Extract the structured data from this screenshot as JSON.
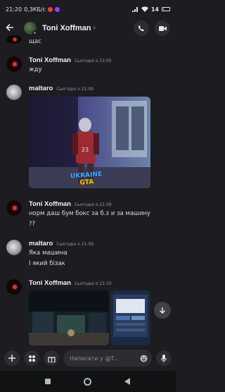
{
  "status_bar": {
    "time": "21:20",
    "speed": "0,3КБ/с",
    "battery": "14"
  },
  "header": {
    "contact_name": "Toni Xoffman",
    "chevron": "›"
  },
  "composer": {
    "placeholder": "Написати у @T..."
  },
  "messages": [
    {
      "author": "",
      "timestamp": "",
      "lines": [
        "щас"
      ]
    },
    {
      "author": "Toni Xoffman",
      "timestamp": "Сьогодні о 21:05",
      "lines": [
        "жду"
      ]
    },
    {
      "author": "maltaro",
      "timestamp": "Сьогодні о 21:09",
      "lines": []
    },
    {
      "author": "Toni Xoffman",
      "timestamp": "Сьогодні о 21:09",
      "lines": [
        "норм даш бум бокс за б.з и за машину",
        "??"
      ]
    },
    {
      "author": "maltaro",
      "timestamp": "Сьогодні о 21:09",
      "lines": [
        "Яка машина",
        "І який бізак"
      ]
    },
    {
      "author": "Toni Xoffman",
      "timestamp": "Сьогодні о 21:10",
      "lines": []
    }
  ],
  "image_overlay": {
    "jersey_number": "23",
    "watermark_line1": "UKRAINE",
    "watermark_line2": "GTA"
  },
  "colors": {
    "background": "#1c1c21",
    "online": "#23a55a",
    "accent": "#5865f2"
  }
}
